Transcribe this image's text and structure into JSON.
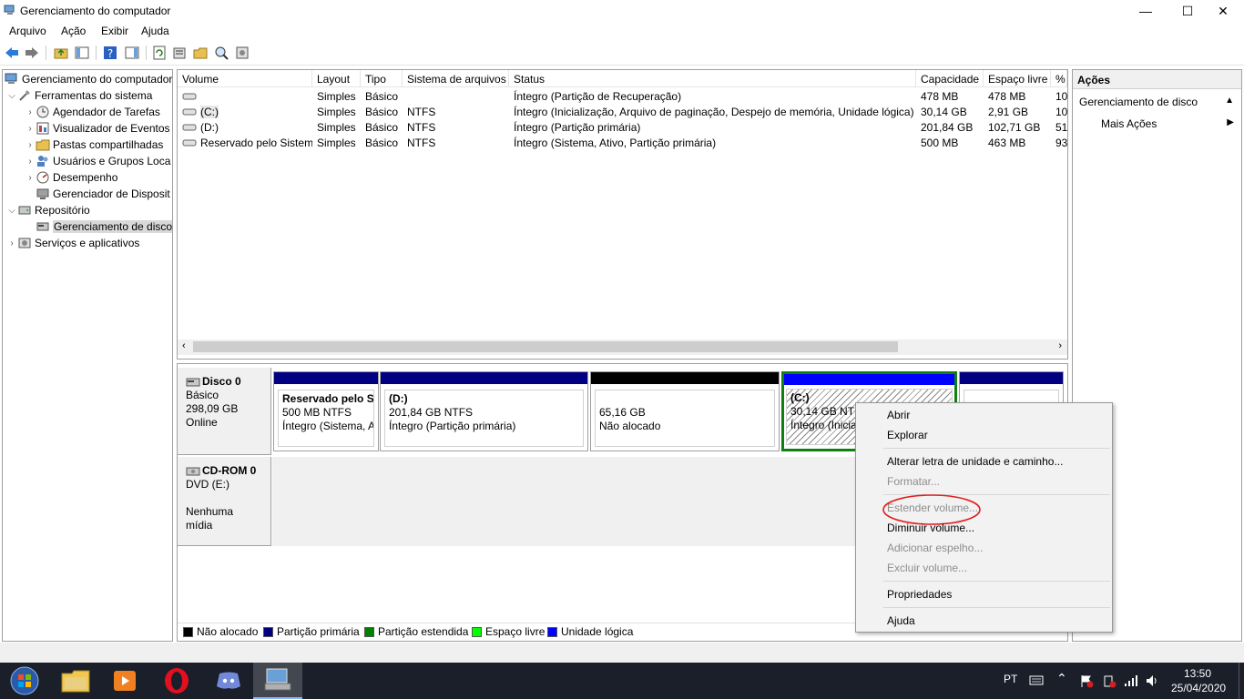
{
  "window": {
    "title": "Gerenciamento do computador",
    "controls": {
      "minimize": "—",
      "maximize": "☐",
      "close": "✕"
    }
  },
  "menu": {
    "items": [
      "Arquivo",
      "Ação",
      "Exibir",
      "Ajuda"
    ]
  },
  "tree": {
    "root": "Gerenciamento do computador",
    "items": [
      {
        "label": "Ferramentas do sistema",
        "icon": "tools-icon"
      },
      {
        "label": "Agendador de Tarefas",
        "icon": "clock-icon"
      },
      {
        "label": "Visualizador de Eventos",
        "icon": "event-viewer-icon"
      },
      {
        "label": "Pastas compartilhadas",
        "icon": "shared-folder-icon"
      },
      {
        "label": "Usuários e Grupos Loca",
        "icon": "users-icon"
      },
      {
        "label": "Desempenho",
        "icon": "performance-icon"
      },
      {
        "label": "Gerenciador de Disposit",
        "icon": "device-manager-icon"
      },
      {
        "label": "Repositório",
        "icon": "storage-icon"
      },
      {
        "label": "Gerenciamento de disco",
        "icon": "disk-management-icon"
      },
      {
        "label": "Serviços e aplicativos",
        "icon": "services-icon"
      }
    ]
  },
  "volumes": {
    "columns": [
      "Volume",
      "Layout",
      "Tipo",
      "Sistema de arquivos",
      "Status",
      "Capacidade",
      "Espaço livre",
      "%"
    ],
    "rows": [
      [
        "",
        "Simples",
        "Básico",
        "",
        "Íntegro (Partição de Recuperação)",
        "478 MB",
        "478 MB",
        "10"
      ],
      [
        "(C:)",
        "Simples",
        "Básico",
        "NTFS",
        "Íntegro (Inicialização, Arquivo de paginação, Despejo de memória, Unidade lógica)",
        "30,14 GB",
        "2,91 GB",
        "10"
      ],
      [
        "(D:)",
        "Simples",
        "Básico",
        "NTFS",
        "Íntegro (Partição primária)",
        "201,84 GB",
        "102,71 GB",
        "51"
      ],
      [
        "Reservado pelo Sistema",
        "Simples",
        "Básico",
        "NTFS",
        "Íntegro (Sistema, Ativo, Partição primária)",
        "500 MB",
        "463 MB",
        "93"
      ]
    ]
  },
  "disks": {
    "disk0": {
      "name": "Disco 0",
      "type": "Básico",
      "size": "298,09 GB",
      "state": "Online",
      "partitions": [
        {
          "title": "Reservado pelo Sis",
          "line2": "500 MB NTFS",
          "line3": "Íntegro (Sistema, At"
        },
        {
          "title": "(D:)",
          "line2": "201,84 GB NTFS",
          "line3": "Íntegro (Partição primária)"
        },
        {
          "title": "",
          "line2": "65,16 GB",
          "line3": "Não alocado"
        },
        {
          "title": "(C:)",
          "line2": "30,14 GB NTFS",
          "line3": "Íntegro (Inicia"
        },
        {
          "title": "",
          "line2": "",
          "line3": ""
        }
      ]
    },
    "cdrom": {
      "name": "CD-ROM 0",
      "type": "DVD (E:)",
      "state": "Nenhuma mídia"
    }
  },
  "legend": [
    {
      "label": "Não alocado",
      "color": "#000000"
    },
    {
      "label": "Partição primária",
      "color": "#000080"
    },
    {
      "label": "Partição estendida",
      "color": "#008000"
    },
    {
      "label": "Espaço livre",
      "color": "#00ff00"
    },
    {
      "label": "Unidade lógica",
      "color": "#0000ff"
    }
  ],
  "actions": {
    "header": "Ações",
    "section": "Gerenciamento de disco",
    "more": "Mais Ações"
  },
  "context_menu": {
    "items": [
      {
        "label": "Abrir",
        "enabled": true
      },
      {
        "label": "Explorar",
        "enabled": true
      },
      {
        "label": "Alterar letra de unidade e caminho...",
        "enabled": true
      },
      {
        "label": "Formatar...",
        "enabled": false
      },
      {
        "label": "Estender volume...",
        "enabled": false
      },
      {
        "label": "Diminuir volume...",
        "enabled": true
      },
      {
        "label": "Adicionar espelho...",
        "enabled": false
      },
      {
        "label": "Excluir volume...",
        "enabled": false
      },
      {
        "label": "Propriedades",
        "enabled": true
      },
      {
        "label": "Ajuda",
        "enabled": true
      }
    ]
  },
  "taskbar": {
    "apps": [
      "start-orb",
      "explorer",
      "media-player",
      "opera",
      "discord",
      "computer-management"
    ],
    "lang": "PT",
    "time": "13:50",
    "date": "25/04/2020"
  }
}
